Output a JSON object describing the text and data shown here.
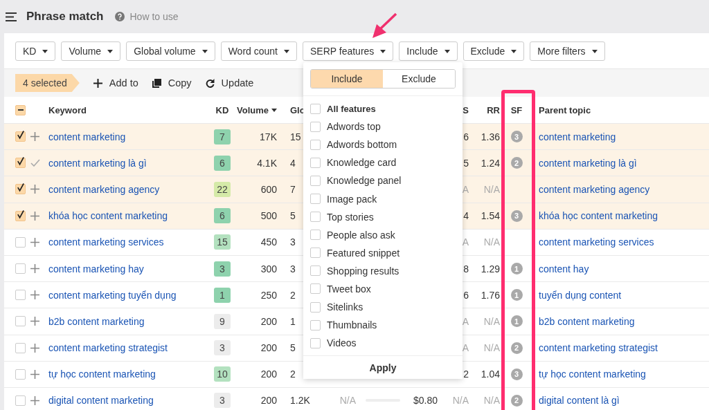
{
  "header": {
    "title": "Phrase match",
    "help": "How to use"
  },
  "filters": [
    "KD",
    "Volume",
    "Global volume",
    "Word count",
    "SERP features",
    "Include",
    "Exclude",
    "More filters"
  ],
  "selection": {
    "count": "4 selected",
    "actions": [
      {
        "kind": "add",
        "label": "Add to"
      },
      {
        "kind": "copy",
        "label": "Copy"
      },
      {
        "kind": "update",
        "label": "Update"
      }
    ]
  },
  "table": {
    "indeterminate": true,
    "columns": {
      "keyword": "Keyword",
      "kd": "KD",
      "volume": "Volume",
      "global": "Glo",
      "column_s": "S",
      "rr": "RR",
      "sf": "SF",
      "parent": "Parent topic"
    },
    "volume_sorted": true,
    "rows": [
      {
        "checked": true,
        "added": false,
        "keyword": "content marketing",
        "kd": {
          "text": "7",
          "color": "#8ed2ad"
        },
        "volume": "17K",
        "global": "15",
        "column_s": "6",
        "rr": "1.36",
        "sf": "3",
        "parent": "content marketing"
      },
      {
        "checked": true,
        "added": true,
        "keyword": "content marketing là gì",
        "kd": {
          "text": "6",
          "color": "#8ed2ad"
        },
        "volume": "4.1K",
        "global": "4",
        "column_s": "5",
        "rr": "1.24",
        "sf": "2",
        "parent": "content marketing là gì"
      },
      {
        "checked": true,
        "added": false,
        "keyword": "content marketing agency",
        "kd": {
          "text": "22",
          "color": "#d5eaa8"
        },
        "volume": "600",
        "global": "7",
        "column_s": "A",
        "rr": "N/A",
        "parent": "content marketing agency"
      },
      {
        "checked": true,
        "added": false,
        "keyword": "khóa học content marketing",
        "kd": {
          "text": "6",
          "color": "#8ed2ad"
        },
        "volume": "500",
        "global": "5",
        "column_s": "4",
        "rr": "1.54",
        "sf": "3",
        "parent": "khóa học content marketing"
      },
      {
        "checked": false,
        "added": false,
        "keyword": "content marketing services",
        "kd": {
          "text": "15",
          "color": "#b3e1bf"
        },
        "volume": "450",
        "global": "3",
        "column_s": "A",
        "rr": "N/A",
        "parent": "content marketing services"
      },
      {
        "checked": false,
        "added": false,
        "keyword": "content marketing hay",
        "kd": {
          "text": "3",
          "color": "#8ed2ad"
        },
        "volume": "300",
        "global": "3",
        "column_s": "8",
        "rr": "1.29",
        "sf": "1",
        "parent": "content hay"
      },
      {
        "checked": false,
        "added": false,
        "keyword": "content marketing tuyển dụng",
        "kd": {
          "text": "1",
          "color": "#8ed2ad"
        },
        "volume": "250",
        "global": "2",
        "column_s": "6",
        "rr": "1.76",
        "sf": "1",
        "parent": "tuyển dụng content"
      },
      {
        "checked": false,
        "added": false,
        "keyword": "b2b content marketing",
        "kd": {
          "text": "9",
          "color": "#ececec"
        },
        "volume": "200",
        "global": "1",
        "column_s": "A",
        "rr": "N/A",
        "sf": "1",
        "parent": "b2b content marketing"
      },
      {
        "checked": false,
        "added": false,
        "keyword": "content marketing strategist",
        "kd": {
          "text": "3",
          "color": "#ececec"
        },
        "volume": "200",
        "global": "5",
        "column_s": "A",
        "rr": "N/A",
        "sf": "2",
        "parent": "content marketing strategist"
      },
      {
        "checked": false,
        "added": false,
        "keyword": "tự học content marketing",
        "kd": {
          "text": "10",
          "color": "#b3e1bf"
        },
        "volume": "200",
        "global": "2",
        "column_s": "2",
        "rr": "1.04",
        "sf": "3",
        "parent": "tự học content marketing"
      },
      {
        "checked": false,
        "added": false,
        "keyword": "digital content marketing",
        "kd": {
          "text": "3",
          "color": "#ececec"
        },
        "volume": "200",
        "global": "1.2K",
        "column_traffic": "N/A",
        "column_cpc": "$0.80",
        "column_s": "N/A",
        "rr": "N/A",
        "sf": "2",
        "parent": "digital content là gì"
      }
    ]
  },
  "dropdown": {
    "modes": [
      {
        "label": "Include",
        "selected": true
      },
      {
        "label": "Exclude",
        "selected": false
      }
    ],
    "options": [
      {
        "kind": "all",
        "label": "All features",
        "checked": false
      },
      {
        "kind": "feature",
        "label": "Adwords top",
        "checked": false
      },
      {
        "kind": "feature",
        "label": "Adwords bottom",
        "checked": false
      },
      {
        "kind": "feature",
        "label": "Knowledge card",
        "checked": false
      },
      {
        "kind": "feature",
        "label": "Knowledge panel",
        "checked": false
      },
      {
        "kind": "feature",
        "label": "Image pack",
        "checked": false
      },
      {
        "kind": "feature",
        "label": "Top stories",
        "checked": false
      },
      {
        "kind": "feature",
        "label": "People also ask",
        "checked": false
      },
      {
        "kind": "feature",
        "label": "Featured snippet",
        "checked": false
      },
      {
        "kind": "feature",
        "label": "Shopping results",
        "checked": false
      },
      {
        "kind": "feature",
        "label": "Tweet box",
        "checked": false
      },
      {
        "kind": "feature",
        "label": "Sitelinks",
        "checked": false
      },
      {
        "kind": "feature",
        "label": "Thumbnails",
        "checked": false
      },
      {
        "kind": "feature",
        "label": "Videos",
        "checked": false
      }
    ],
    "apply": "Apply"
  },
  "annotations": {
    "arrow": true,
    "frame": true
  }
}
